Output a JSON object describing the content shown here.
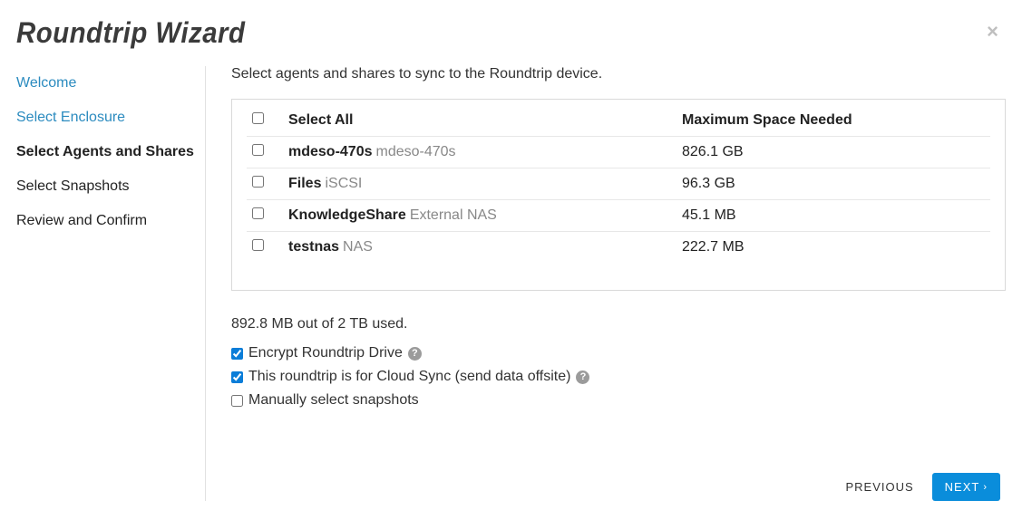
{
  "title": "Roundtrip Wizard",
  "sidebar": {
    "items": [
      {
        "label": "Welcome",
        "state": "done"
      },
      {
        "label": "Select Enclosure",
        "state": "done"
      },
      {
        "label": "Select Agents and Shares",
        "state": "active"
      },
      {
        "label": "Select Snapshots",
        "state": "upcoming"
      },
      {
        "label": "Review and Confirm",
        "state": "upcoming"
      }
    ]
  },
  "main": {
    "instruction": "Select agents and shares to sync to the Roundtrip device.",
    "table": {
      "header": {
        "select_all": "Select All",
        "space": "Maximum Space Needed"
      },
      "rows": [
        {
          "name": "mdeso-470s",
          "sub": "mdeso-470s",
          "size": "826.1 GB",
          "checked": false
        },
        {
          "name": "Files",
          "sub": "iSCSI",
          "size": "96.3 GB",
          "checked": false
        },
        {
          "name": "KnowledgeShare",
          "sub": "External NAS",
          "size": "45.1 MB",
          "checked": false
        },
        {
          "name": "testnas",
          "sub": "NAS",
          "size": "222.7 MB",
          "checked": false
        }
      ]
    },
    "usage": "892.8 MB out of 2 TB used.",
    "options": {
      "encrypt": {
        "label": "Encrypt Roundtrip Drive",
        "checked": true,
        "help": true
      },
      "cloud_sync": {
        "label": "This roundtrip is for Cloud Sync (send data offsite)",
        "checked": true,
        "help": true
      },
      "manual_snapshots": {
        "label": "Manually select snapshots",
        "checked": false,
        "help": false
      }
    }
  },
  "footer": {
    "previous": "PREVIOUS",
    "next": "NEXT"
  }
}
